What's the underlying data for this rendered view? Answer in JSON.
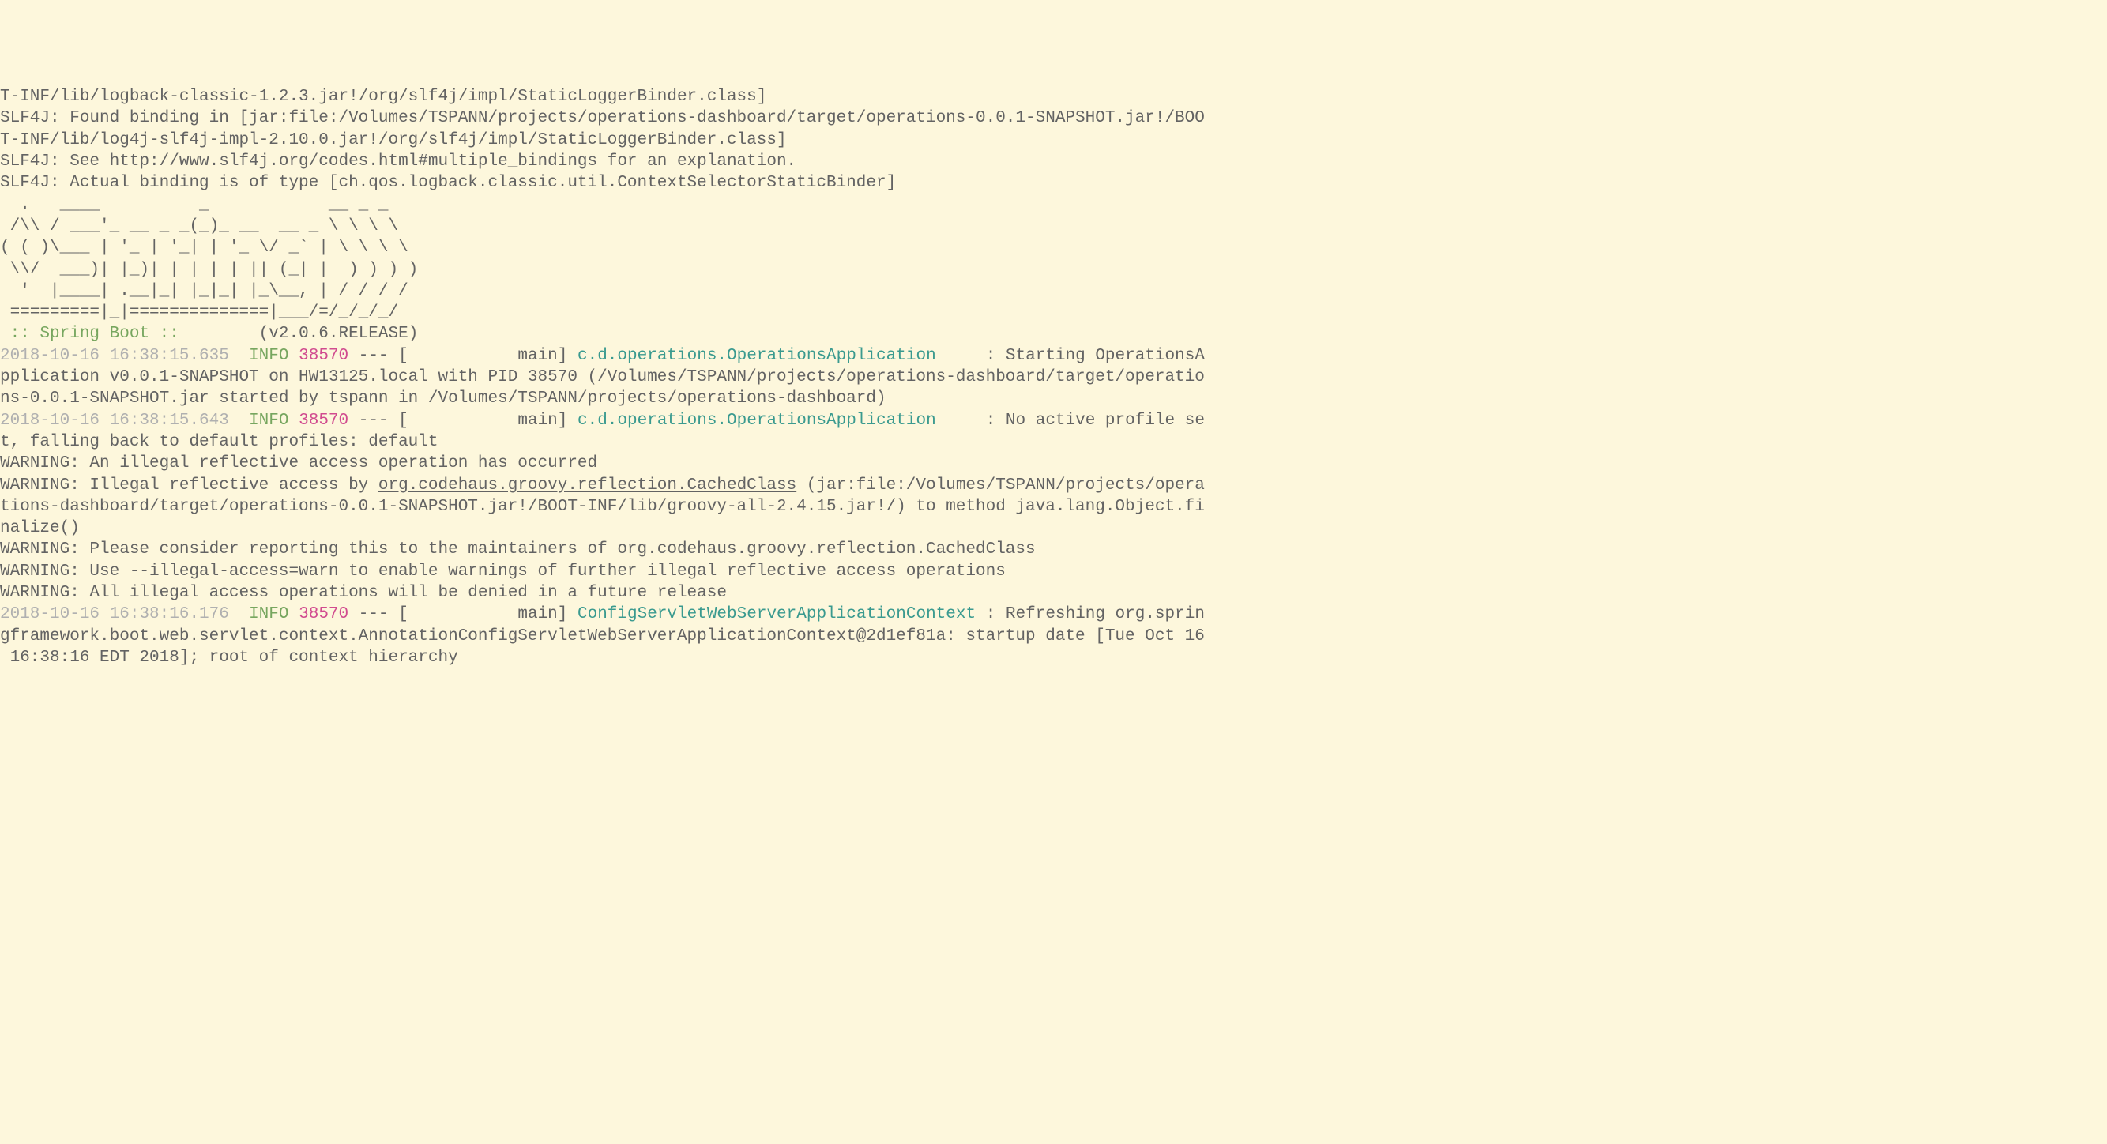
{
  "colors": {
    "background": "#fdf7dc",
    "text_default": "#636363",
    "timestamp": "#b0b0b0",
    "info_level": "#77a65f",
    "pid": "#d14b8f",
    "logger": "#3a9a8f",
    "spring_banner": "#77a65f"
  },
  "lines": {
    "l1": "T-INF/lib/logback-classic-1.2.3.jar!/org/slf4j/impl/StaticLoggerBinder.class]",
    "l2": "SLF4J: Found binding in [jar:file:/Volumes/TSPANN/projects/operations-dashboard/target/operations-0.0.1-SNAPSHOT.jar!/BOO",
    "l3": "T-INF/lib/log4j-slf4j-impl-2.10.0.jar!/org/slf4j/impl/StaticLoggerBinder.class]",
    "l4": "SLF4J: See http://www.slf4j.org/codes.html#multiple_bindings for an explanation.",
    "l5": "SLF4J: Actual binding is of type [ch.qos.logback.classic.util.ContextSelectorStaticBinder]",
    "l6": "",
    "banner1": "  .   ____          _            __ _ _",
    "banner2": " /\\\\ / ___'_ __ _ _(_)_ __  __ _ \\ \\ \\ \\",
    "banner3": "( ( )\\___ | '_ | '_| | '_ \\/ _` | \\ \\ \\ \\",
    "banner4": " \\\\/  ___)| |_)| | | | | || (_| |  ) ) ) )",
    "banner5": "  '  |____| .__|_| |_|_| |_\\__, | / / / /",
    "banner6": " =========|_|==============|___/=/_/_/_/",
    "spring_label": " :: Spring Boot :: ",
    "spring_version": "       (v2.0.6.RELEASE)",
    "blank2": "",
    "log1_ts": "2018-10-16 16:38:15.635",
    "log1_level": "INFO",
    "log1_pid": "38570",
    "log1_sep": " --- [",
    "log1_thread": "           main",
    "log1_bracket": "] ",
    "log1_logger": "c.d.operations.OperationsApplication    ",
    "log1_colon": " : ",
    "log1_msg": "Starting OperationsA",
    "log1_cont1": "pplication v0.0.1-SNAPSHOT on HW13125.local with PID 38570 (/Volumes/TSPANN/projects/operations-dashboard/target/operatio",
    "log1_cont2": "ns-0.0.1-SNAPSHOT.jar started by tspann in /Volumes/TSPANN/projects/operations-dashboard)",
    "log2_ts": "2018-10-16 16:38:15.643",
    "log2_level": "INFO",
    "log2_pid": "38570",
    "log2_sep": " --- [",
    "log2_thread": "           main",
    "log2_bracket": "] ",
    "log2_logger": "c.d.operations.OperationsApplication    ",
    "log2_colon": " : ",
    "log2_msg": "No active profile se",
    "log2_cont1": "t, falling back to default profiles: default",
    "warn1": "WARNING: An illegal reflective access operation has occurred",
    "warn2a": "WARNING: Illegal reflective access by ",
    "warn2_link": "org.codehaus.groovy.reflection.CachedClass",
    "warn2b": " (jar:file:/Volumes/TSPANN/projects/opera",
    "warn2_cont": "tions-dashboard/target/operations-0.0.1-SNAPSHOT.jar!/BOOT-INF/lib/groovy-all-2.4.15.jar!/) to method java.lang.Object.fi",
    "warn2_cont2": "nalize()",
    "warn3": "WARNING: Please consider reporting this to the maintainers of org.codehaus.groovy.reflection.CachedClass",
    "warn4": "WARNING: Use --illegal-access=warn to enable warnings of further illegal reflective access operations",
    "warn5": "WARNING: All illegal access operations will be denied in a future release",
    "log3_ts": "2018-10-16 16:38:16.176",
    "log3_level": "INFO",
    "log3_pid": "38570",
    "log3_sep": " --- [",
    "log3_thread": "           main",
    "log3_bracket": "] ",
    "log3_logger": "ConfigServletWebServerApplicationContext",
    "log3_colon": " : ",
    "log3_msg": "Refreshing org.sprin",
    "log3_cont1": "gframework.boot.web.servlet.context.AnnotationConfigServletWebServerApplicationContext@2d1ef81a: startup date [Tue Oct 16",
    "log3_cont2": " 16:38:16 EDT 2018]; root of context hierarchy"
  }
}
